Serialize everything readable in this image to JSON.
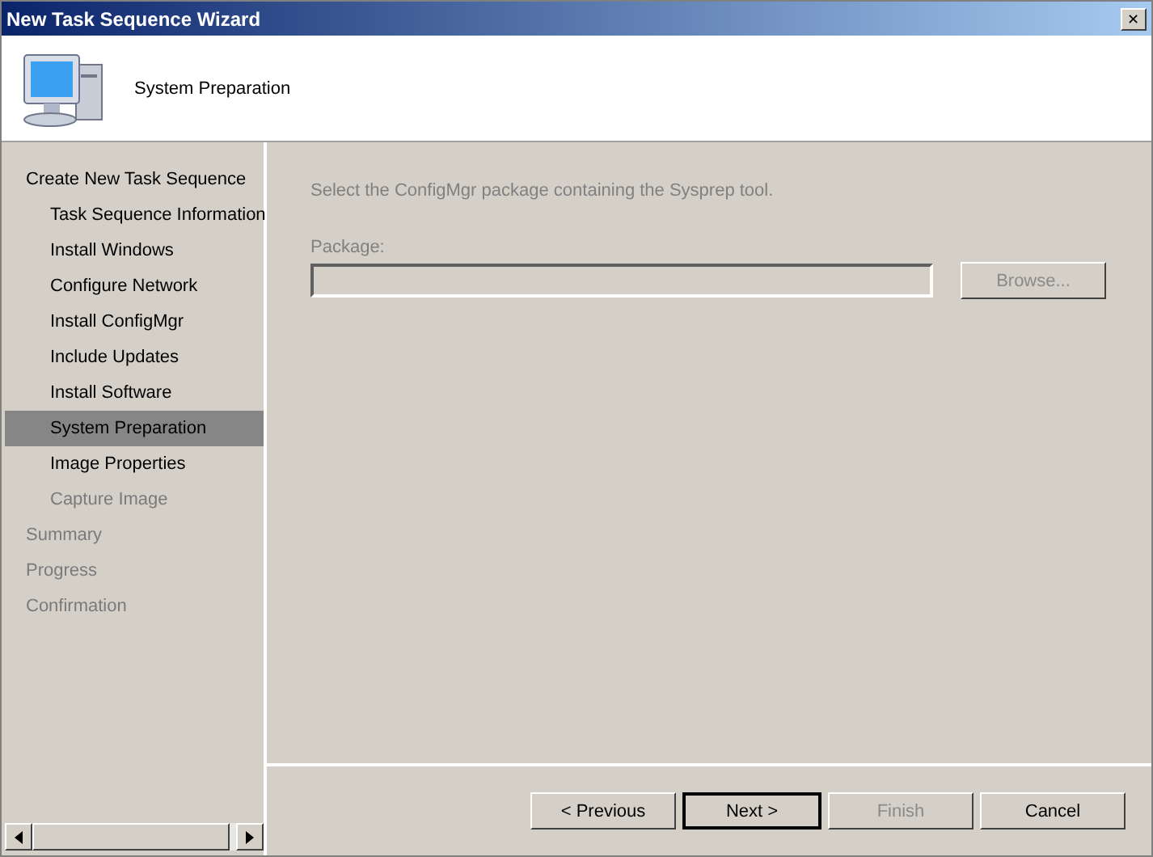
{
  "window": {
    "title": "New Task Sequence Wizard",
    "close": "✕"
  },
  "header": {
    "title": "System Preparation"
  },
  "steps": [
    {
      "label": "Create New Task Sequence",
      "selected": false,
      "disabled": false,
      "children": [
        {
          "label": "Task Sequence Information",
          "selected": false,
          "disabled": false
        },
        {
          "label": "Install Windows",
          "selected": false,
          "disabled": false
        },
        {
          "label": "Configure Network",
          "selected": false,
          "disabled": false
        },
        {
          "label": "Install ConfigMgr",
          "selected": false,
          "disabled": false
        },
        {
          "label": "Include Updates",
          "selected": false,
          "disabled": false
        },
        {
          "label": "Install Software",
          "selected": false,
          "disabled": false
        },
        {
          "label": "System Preparation",
          "selected": true,
          "disabled": false
        },
        {
          "label": "Image Properties",
          "selected": false,
          "disabled": false
        },
        {
          "label": "Capture Image",
          "selected": false,
          "disabled": true
        }
      ]
    },
    {
      "label": "Summary",
      "selected": false,
      "disabled": true
    },
    {
      "label": "Progress",
      "selected": false,
      "disabled": true
    },
    {
      "label": "Confirmation",
      "selected": false,
      "disabled": true
    }
  ],
  "content": {
    "instruction": "Select the ConfigMgr package containing the Sysprep tool.",
    "package_label": "Package:",
    "browse": {
      "label": "Browse...",
      "disabled": true
    }
  },
  "buttons": [
    {
      "label": "< Previous",
      "disabled": false,
      "default": false
    },
    {
      "label": "Next >",
      "disabled": false,
      "default": true
    },
    {
      "label": "Finish",
      "disabled": true,
      "default": false
    },
    {
      "label": "Cancel",
      "disabled": false,
      "default": false
    }
  ]
}
